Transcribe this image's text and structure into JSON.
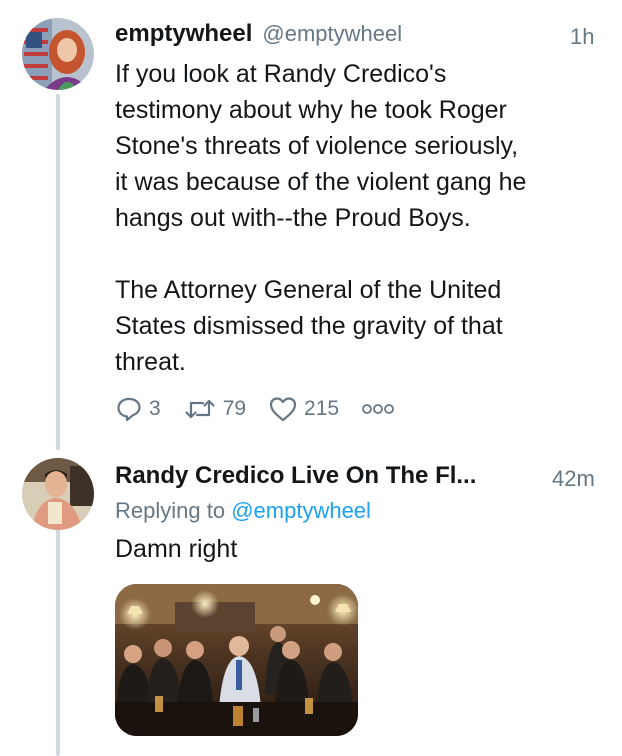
{
  "tweet1": {
    "display_name": "emptywheel",
    "handle": "@emptywheel",
    "time": "1h",
    "paragraph1_lines": [
      "If you look at Randy Credico's",
      "testimony about why he took Roger",
      "Stone's threats of violence seriously,",
      "it was because of the violent gang he",
      "hangs out with--the Proud Boys."
    ],
    "paragraph2_lines": [
      "The Attorney General of the United",
      "States dismissed the gravity of that",
      "threat."
    ],
    "reply_count": "3",
    "retweet_count": "79",
    "like_count": "215",
    "icons": {
      "reply": "reply-icon",
      "retweet": "retweet-icon",
      "like": "like-icon",
      "more": "more-icon"
    }
  },
  "tweet2": {
    "display_name": "Randy Credico Live On The Fl...",
    "time": "42m",
    "replying_prefix": "Replying to",
    "replying_mention": "@emptywheel",
    "text": "Damn right"
  },
  "colors": {
    "text": "#14171a",
    "secondary": "#657786",
    "link": "#1da1f2",
    "thread_line": "#cfd9de"
  }
}
